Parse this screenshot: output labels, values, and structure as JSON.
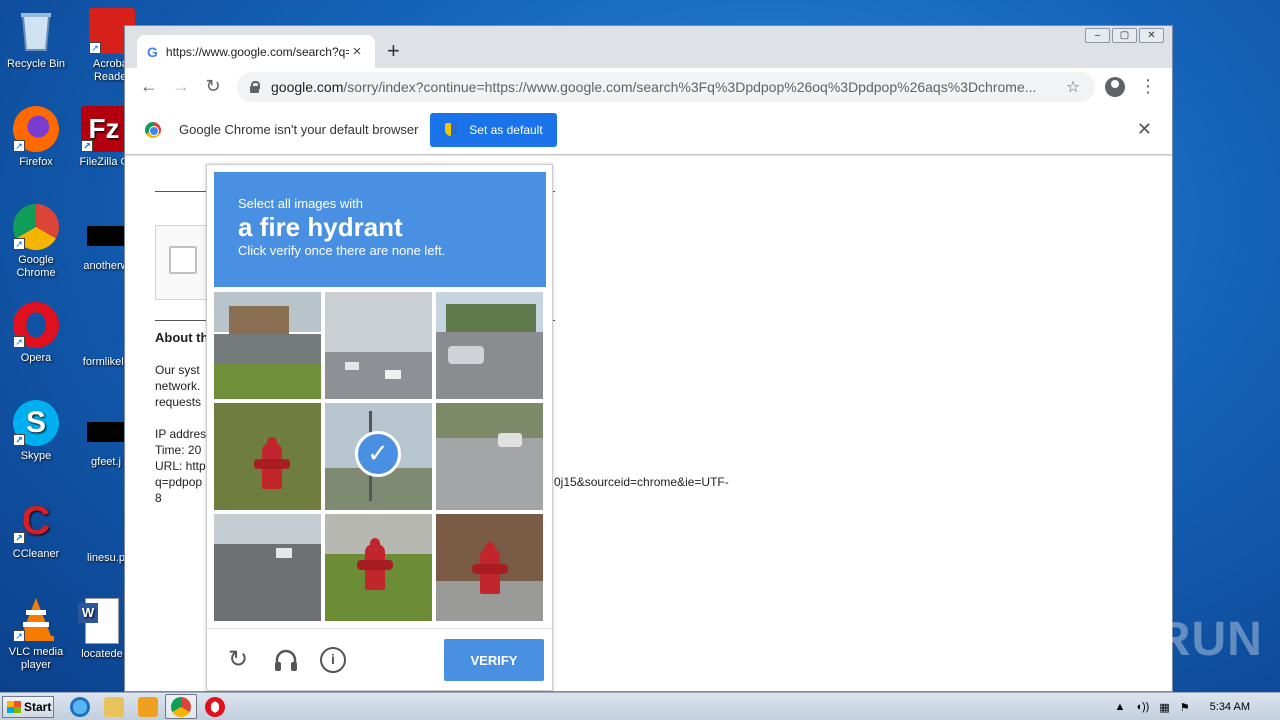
{
  "desktop": {
    "icons": [
      {
        "label": "Recycle Bin"
      },
      {
        "label": "Acrobat Reader"
      },
      {
        "label": "Firefox"
      },
      {
        "label": "FileZilla C"
      },
      {
        "label": "Google Chrome"
      },
      {
        "label": "anotherw"
      },
      {
        "label": "Opera"
      },
      {
        "label": "formlikely"
      },
      {
        "label": "Skype"
      },
      {
        "label": "gfeet.j"
      },
      {
        "label": "CCleaner"
      },
      {
        "label": "linesu.p"
      },
      {
        "label": "VLC media player"
      },
      {
        "label": "locatede"
      }
    ],
    "watermark": "ANY RUN"
  },
  "browser": {
    "tab_title": "https://www.google.com/search?q=",
    "tab_close": "×",
    "new_tab": "+",
    "url_host": "google.com",
    "url_rest": "/sorry/index?continue=https://www.google.com/search%3Fq%3Dpdpop%26oq%3Dpdpop%26aqs%3Dchrome...",
    "infobar_message": "Google Chrome isn't your default browser",
    "set_default_label": "Set as default"
  },
  "page": {
    "about_heading": "About th",
    "para1_l1": "Our syst",
    "para1_l2": "network.",
    "para1_l3": "requests",
    "ip_label": "IP addres",
    "time_label": "Time: 20",
    "url_label": "URL: http",
    "url_cont": "q=pdpop",
    "url_tail": "0j15&sourceid=chrome&ie=UTF-",
    "url_tail2": "8"
  },
  "captcha": {
    "line1": "Select all images with",
    "line2": "a fire hydrant",
    "line3": "Click verify once there are none left.",
    "verify_label": "VERIFY",
    "colors": {
      "header": "#4a90e2",
      "button": "#4a90e2"
    }
  },
  "taskbar": {
    "start_label": "Start",
    "clock": "5:34 AM"
  }
}
